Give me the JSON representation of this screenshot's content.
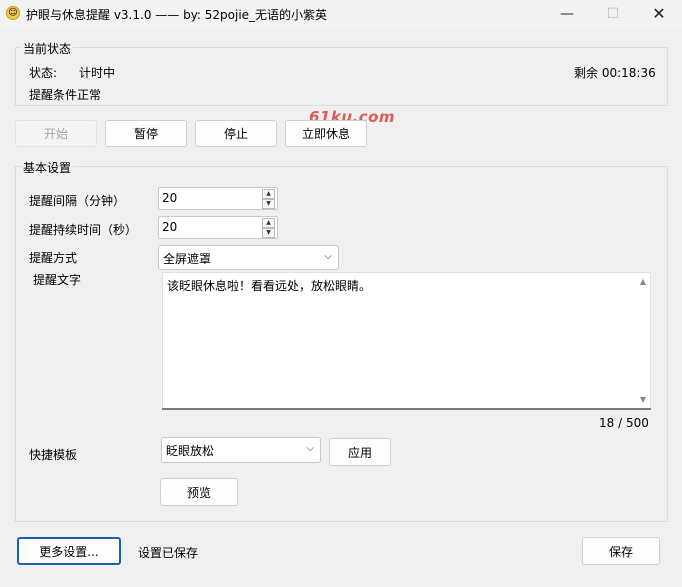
{
  "window": {
    "title": "护眼与休息提醒   v3.1.0   —— by: 52pojie_无语的小紫英",
    "min_glyph": "—",
    "max_glyph": "☐",
    "close_glyph": "✕"
  },
  "status": {
    "group_title": "当前状态",
    "state_label": "状态:",
    "state_value": "计时中",
    "remaining": "剩余 00:18:36",
    "condition": "提醒条件正常"
  },
  "watermark": "61ku.com",
  "actions": {
    "start": "开始",
    "pause": "暂停",
    "stop": "停止",
    "rest_now": "立即休息"
  },
  "settings": {
    "group_title": "基本设置",
    "interval_label": "提醒间隔（分钟）",
    "interval_value": "20",
    "duration_label": "提醒持续时间（秒）",
    "duration_value": "20",
    "mode_label": "提醒方式",
    "mode_value": "全屏遮罩",
    "text_label": "提醒文字",
    "text_value": "该眨眼休息啦！看看远处，放松眼睛。",
    "char_count": "18 / 500",
    "template_label": "快捷模板",
    "template_value": "眨眼放松",
    "apply": "应用",
    "preview": "预览"
  },
  "footer": {
    "more_settings": "更多设置...",
    "saved_status": "设置已保存",
    "save": "保存"
  },
  "icons": {
    "app": "smiley-icon",
    "chevron": "chevron-down-icon",
    "spin_up": "▲",
    "spin_down": "▼",
    "scroll_up": "▲",
    "scroll_down": "▼"
  }
}
